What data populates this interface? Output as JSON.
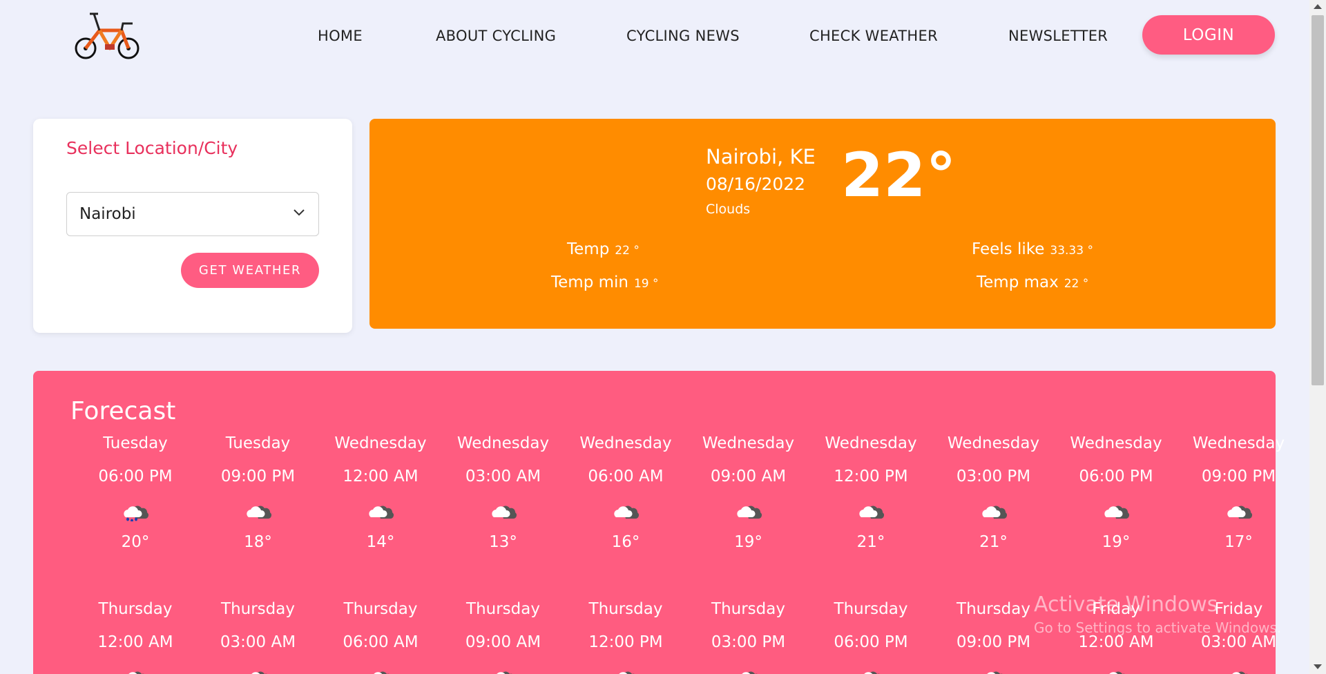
{
  "nav": {
    "items": [
      "HOME",
      "ABOUT CYCLING",
      "CYCLING NEWS",
      "CHECK WEATHER",
      "NEWSLETTER"
    ],
    "login_label": "LOGIN",
    "logo_icon": "bicycle-logo"
  },
  "location": {
    "title": "Select Location/City",
    "selected_city": "Nairobi",
    "button_label": "GET WEATHER"
  },
  "current": {
    "city": "Nairobi, KE",
    "date": "08/16/2022",
    "description": "Clouds",
    "temperature": "22°",
    "temp_label": "Temp",
    "temp_value": "22 °",
    "temp_min_label": "Temp min",
    "temp_min_value": "19 °",
    "feels_like_label": "Feels like",
    "feels_like_value": "33.33 °",
    "temp_max_label": "Temp max",
    "temp_max_value": "22 °"
  },
  "forecast": {
    "title": "Forecast",
    "entries": [
      {
        "day": "Tuesday",
        "time": "06:00 PM",
        "icon": "rain-cloud-icon",
        "temp": "20°"
      },
      {
        "day": "Tuesday",
        "time": "09:00 PM",
        "icon": "cloud-icon",
        "temp": "18°"
      },
      {
        "day": "Wednesday",
        "time": "12:00 AM",
        "icon": "cloud-icon",
        "temp": "14°"
      },
      {
        "day": "Wednesday",
        "time": "03:00 AM",
        "icon": "cloud-icon",
        "temp": "13°"
      },
      {
        "day": "Wednesday",
        "time": "06:00 AM",
        "icon": "cloud-icon",
        "temp": "16°"
      },
      {
        "day": "Wednesday",
        "time": "09:00 AM",
        "icon": "cloud-icon",
        "temp": "19°"
      },
      {
        "day": "Wednesday",
        "time": "12:00 PM",
        "icon": "cloud-icon",
        "temp": "21°"
      },
      {
        "day": "Wednesday",
        "time": "03:00 PM",
        "icon": "cloud-icon",
        "temp": "21°"
      },
      {
        "day": "Wednesday",
        "time": "06:00 PM",
        "icon": "cloud-icon",
        "temp": "19°"
      },
      {
        "day": "Wednesday",
        "time": "09:00 PM",
        "icon": "cloud-icon",
        "temp": "17°"
      },
      {
        "day": "Thursday",
        "time": "12:00 AM",
        "icon": "cloud-icon",
        "temp": ""
      },
      {
        "day": "Thursday",
        "time": "03:00 AM",
        "icon": "cloud-icon",
        "temp": ""
      },
      {
        "day": "Thursday",
        "time": "06:00 AM",
        "icon": "cloud-icon",
        "temp": ""
      },
      {
        "day": "Thursday",
        "time": "09:00 AM",
        "icon": "cloud-icon",
        "temp": ""
      },
      {
        "day": "Thursday",
        "time": "12:00 PM",
        "icon": "cloud-icon",
        "temp": ""
      },
      {
        "day": "Thursday",
        "time": "03:00 PM",
        "icon": "cloud-icon",
        "temp": ""
      },
      {
        "day": "Thursday",
        "time": "06:00 PM",
        "icon": "cloud-icon",
        "temp": ""
      },
      {
        "day": "Thursday",
        "time": "09:00 PM",
        "icon": "cloud-icon",
        "temp": ""
      },
      {
        "day": "Friday",
        "time": "12:00 AM",
        "icon": "cloud-icon",
        "temp": ""
      },
      {
        "day": "Friday",
        "time": "03:00 AM",
        "icon": "cloud-icon",
        "temp": ""
      }
    ]
  },
  "watermark": {
    "line1": "Activate Windows",
    "line2": "Go to Settings to activate Windows."
  },
  "colors": {
    "accent_pink": "#ff5c82",
    "current_orange": "#ff8c00",
    "title_red": "#e8305c",
    "page_bg": "#eef0fb"
  }
}
